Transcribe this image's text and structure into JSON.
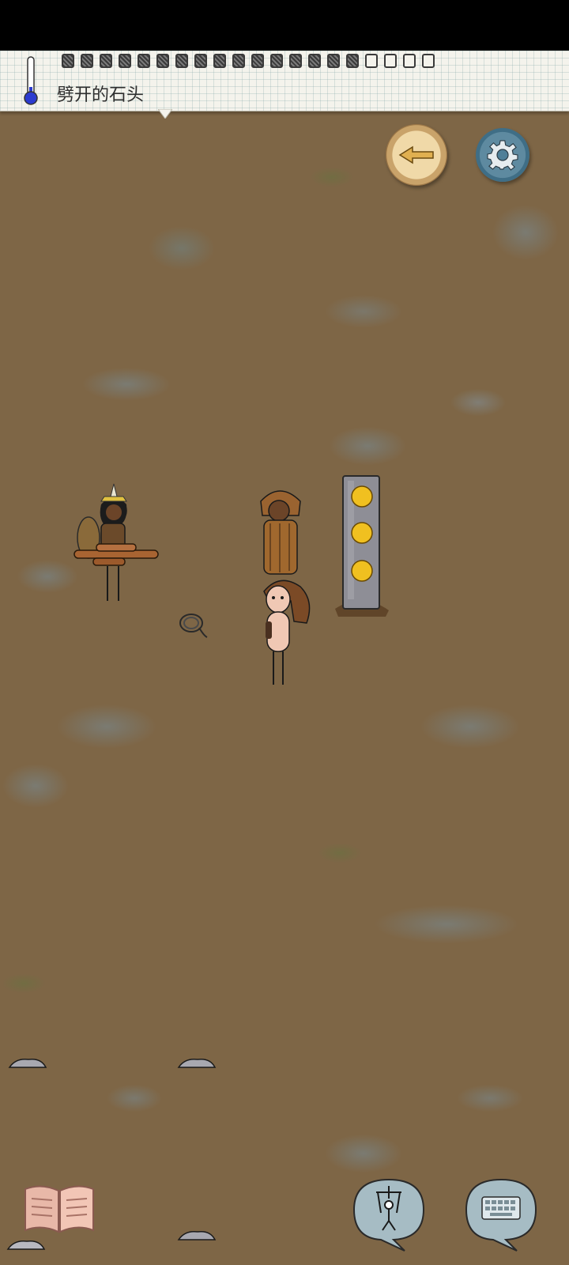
{
  "hud": {
    "status_label": "劈开的石头",
    "food_meter": {
      "filled": 16,
      "total": 20
    },
    "temperature_level": 0.12
  },
  "buttons": {
    "compass_icon": "compass-arrow-left",
    "settings_icon": "gear-icon",
    "tech_book_icon": "open-book-icon",
    "emote_icon": "puppet-icon",
    "keyboard_icon": "keyboard-icon"
  },
  "colors": {
    "ground": "#7e6646",
    "paper": "#f4f3ec",
    "compass_gold": "#e0b050",
    "settings_blue": "#4f7f98",
    "stone_post_gem": "#f0c020"
  }
}
